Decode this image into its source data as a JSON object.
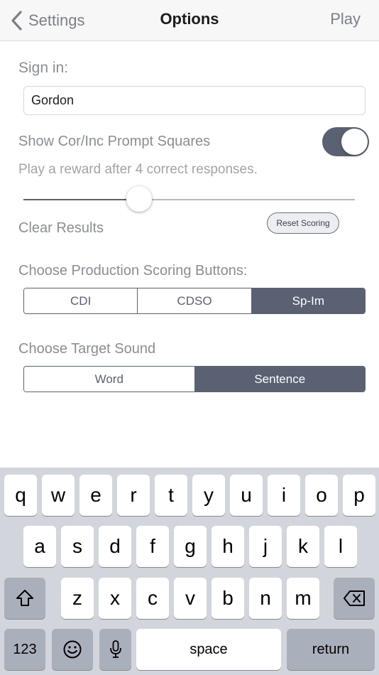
{
  "nav": {
    "back_label": "Settings",
    "title": "Options",
    "play_label": "Play"
  },
  "signin": {
    "label": "Sign in:",
    "value": "Gordon"
  },
  "prompt_squares": {
    "label": "Show Cor/Inc Prompt Squares",
    "enabled": true
  },
  "reward": {
    "text": "Play a reward after 4 correct responses.",
    "count": 4
  },
  "slider": {
    "value_fraction": 0.35
  },
  "clear": {
    "label": "Clear Results",
    "button_label": "Reset Scoring"
  },
  "production_scoring": {
    "label": "Choose Production Scoring Buttons:",
    "options": [
      "CDI",
      "CDSO",
      "Sp-Im"
    ],
    "selected": "Sp-Im"
  },
  "target_sound": {
    "label": "Choose Target Sound",
    "options": [
      "Word",
      "Sentence"
    ],
    "selected": "Sentence"
  },
  "keyboard": {
    "row1": [
      "q",
      "w",
      "e",
      "r",
      "t",
      "y",
      "u",
      "i",
      "o",
      "p"
    ],
    "row2": [
      "a",
      "s",
      "d",
      "f",
      "g",
      "h",
      "j",
      "k",
      "l"
    ],
    "row3": [
      "z",
      "x",
      "c",
      "v",
      "b",
      "n",
      "m"
    ],
    "numbers_label": "123",
    "space_label": "space",
    "return_label": "return",
    "icons": {
      "shift": "shift-icon",
      "delete": "delete-icon",
      "emoji": "emoji-icon",
      "mic": "microphone-icon"
    }
  },
  "colors": {
    "accent": "#5a6172",
    "label_gray": "#8a8d93",
    "keyboard_bg": "#d2d5db",
    "fn_key": "#aab0bb"
  }
}
